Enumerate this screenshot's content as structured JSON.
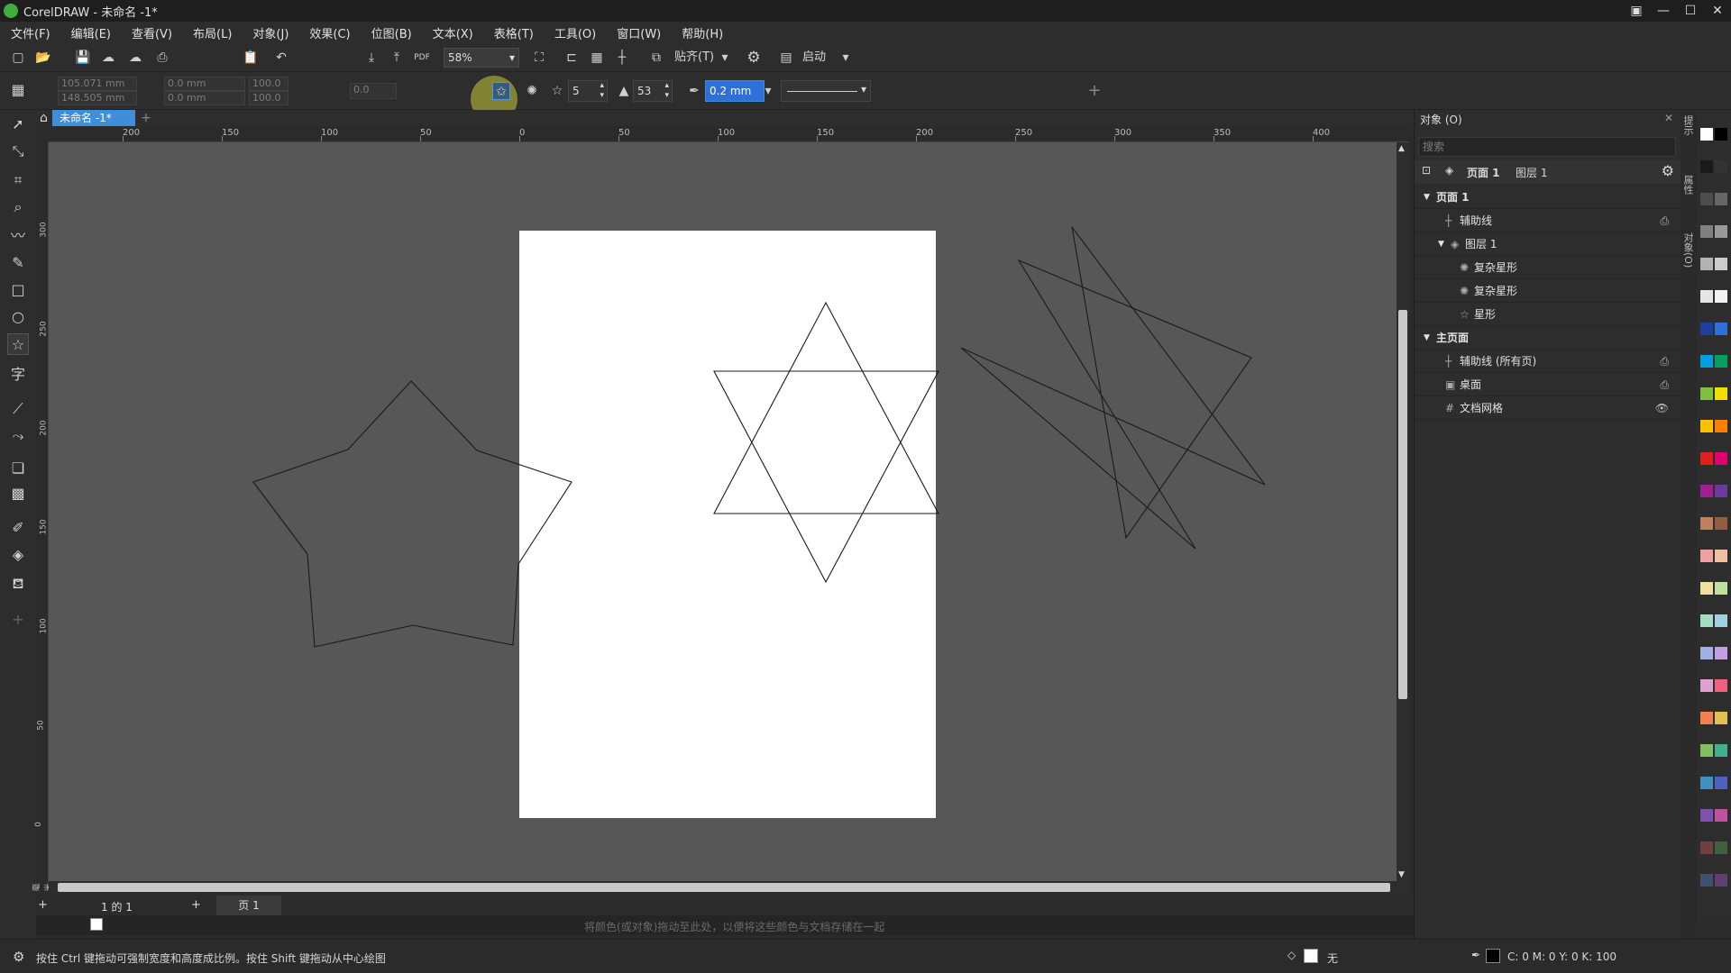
{
  "window": {
    "title": "CorelDRAW - 未命名 -1*",
    "controls": [
      "▣",
      "—",
      "☐",
      "✕"
    ]
  },
  "menu": [
    "文件(F)",
    "编辑(E)",
    "查看(V)",
    "布局(L)",
    "对象(J)",
    "效果(C)",
    "位图(B)",
    "文本(X)",
    "表格(T)",
    "工具(O)",
    "窗口(W)",
    "帮助(H)"
  ],
  "toolbar": {
    "zoom": "58%",
    "snap_label": "贴齐(T)",
    "launch_label": "启动"
  },
  "propbar": {
    "x": "105.071 mm",
    "y": "148.505 mm",
    "w": "0.0 mm",
    "h": "0.0 mm",
    "sx": "100.0",
    "sy": "100.0",
    "angle": "0.0",
    "points": "5",
    "sharpness": "53",
    "outline_width": "0.2 mm"
  },
  "doc_tab": "未命名 -1*",
  "ruler": {
    "h_labels": [
      "200",
      "150",
      "100",
      "50",
      "0",
      "50",
      "100",
      "150",
      "200",
      "250",
      "300",
      "350",
      "400"
    ],
    "v_labels": [
      "300",
      "250",
      "200",
      "150",
      "100",
      "50",
      "0"
    ],
    "unit": "毫米"
  },
  "pagenav": {
    "page_count": "1 的 1",
    "page_tab": "页 1"
  },
  "colorbar_hint": "将颜色(或对象)拖动至此处，以便将这些颜色与文档存储在一起",
  "status": {
    "hint": "按住 Ctrl 键拖动可强制宽度和高度成比例。按住 Shift 键拖动从中心绘图",
    "fill": "无",
    "outline": "C: 0 M: 0 Y: 0 K: 100"
  },
  "panel": {
    "title": "对象 (O)",
    "search_placeholder": "搜索",
    "current_page": "页面 1",
    "current_layer": "图层 1",
    "tree": [
      {
        "label": "页面 1",
        "level": 0,
        "arrow": "▼"
      },
      {
        "label": "辅助线",
        "level": 1,
        "icon": "┼",
        "right": "⎙"
      },
      {
        "label": "图层 1",
        "level": 1,
        "arrow": "▼",
        "icon": "◈"
      },
      {
        "label": "复杂星形",
        "level": 2,
        "icon": "✺"
      },
      {
        "label": "复杂星形",
        "level": 2,
        "icon": "✺"
      },
      {
        "label": "星形",
        "level": 2,
        "icon": "☆"
      },
      {
        "label": "主页面",
        "level": 0,
        "arrow": "▼"
      },
      {
        "label": "辅助线 (所有页)",
        "level": 1,
        "icon": "┼",
        "right": "⎙"
      },
      {
        "label": "桌面",
        "level": 1,
        "icon": "▣",
        "right": "⎙"
      },
      {
        "label": "文档网格",
        "level": 1,
        "icon": "#",
        "right": "👁"
      }
    ]
  },
  "docker_tabs": [
    "提示",
    "属性",
    "对象(O)"
  ],
  "colors": {
    "accent": "#3f8fd8",
    "canvas_bg": "#575757",
    "swatches": [
      "#ffffff",
      "#000000",
      "#1a1a1a",
      "#333333",
      "#4d4d4d",
      "#666666",
      "#808080",
      "#999999",
      "#b3b3b3",
      "#cccccc",
      "#e6e6e6",
      "#f2f2f2",
      "#1f3f9f",
      "#2f6fd8",
      "#00a0e0",
      "#00a060",
      "#7fc040",
      "#f0e000",
      "#ffc000",
      "#ff8000",
      "#e02020",
      "#e0006f",
      "#a0208f",
      "#6a3a9f",
      "#c08060",
      "#8f5f3f",
      "#f0a0a0",
      "#f0c0a0",
      "#f0e0a0",
      "#c0e0a0",
      "#a0e0c0",
      "#a0d0e0",
      "#a0b0e0",
      "#c0a0e0",
      "#e0a0d0",
      "#f06080",
      "#f08050",
      "#e0c050",
      "#80c060",
      "#40b090",
      "#4090c0",
      "#5060c0",
      "#8050b0",
      "#c050a0",
      "#704040",
      "#406040",
      "#405070",
      "#604070"
    ]
  }
}
